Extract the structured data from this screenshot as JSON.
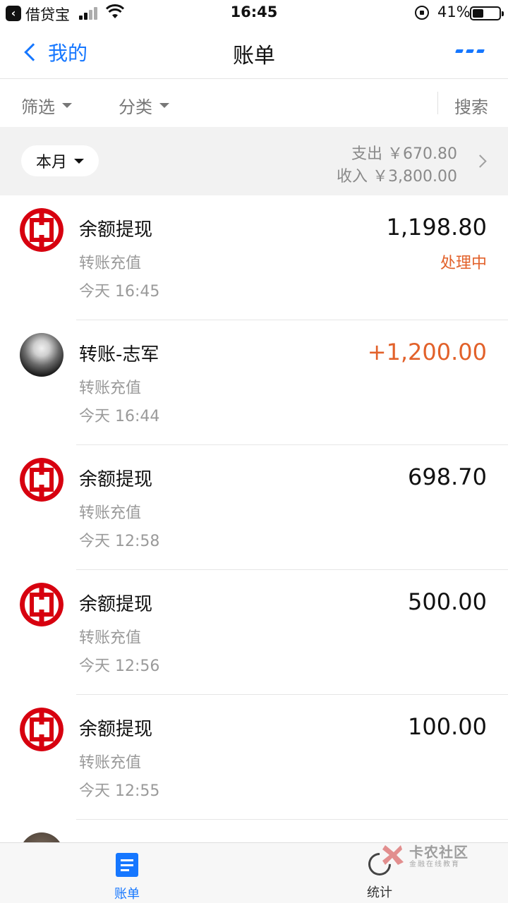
{
  "status_bar": {
    "back_app": "借贷宝",
    "time": "16:45",
    "battery": "41%",
    "battery_level": 0.41
  },
  "nav": {
    "back_label": "我的",
    "title": "账单",
    "more_icon": "more-dots-icon"
  },
  "filters": {
    "filter_label": "筛选",
    "category_label": "分类",
    "search_label": "搜索"
  },
  "summary": {
    "month_label": "本月",
    "expense": "支出 ￥670.80",
    "income": "收入 ￥3,800.00"
  },
  "transactions": [
    {
      "title": "余额提现",
      "subtitle": "转账充值",
      "time": "今天  16:45",
      "amount": "1,198.80",
      "status": "处理中",
      "avatar": "icbc-logo",
      "income": false
    },
    {
      "title": "转账-志军",
      "subtitle": "转账充值",
      "time": "今天  16:44",
      "amount": "+1,200.00",
      "status": "",
      "avatar": "user-photo",
      "income": true
    },
    {
      "title": "余额提现",
      "subtitle": "转账充值",
      "time": "今天  12:58",
      "amount": "698.70",
      "status": "",
      "avatar": "icbc-logo",
      "income": false
    },
    {
      "title": "余额提现",
      "subtitle": "转账充值",
      "time": "今天  12:56",
      "amount": "500.00",
      "status": "",
      "avatar": "icbc-logo",
      "income": false
    },
    {
      "title": "余额提现",
      "subtitle": "转账充值",
      "time": "今天  12:55",
      "amount": "100.00",
      "status": "",
      "avatar": "icbc-logo",
      "income": false
    }
  ],
  "tabbar": {
    "bill_label": "账单",
    "stats_label": "统计"
  },
  "watermark": {
    "title": "卡农社区",
    "subtitle": "金融在线教育"
  },
  "colors": {
    "accent": "#1677ff",
    "income": "#e2612a",
    "icbc_red": "#d7000f"
  }
}
